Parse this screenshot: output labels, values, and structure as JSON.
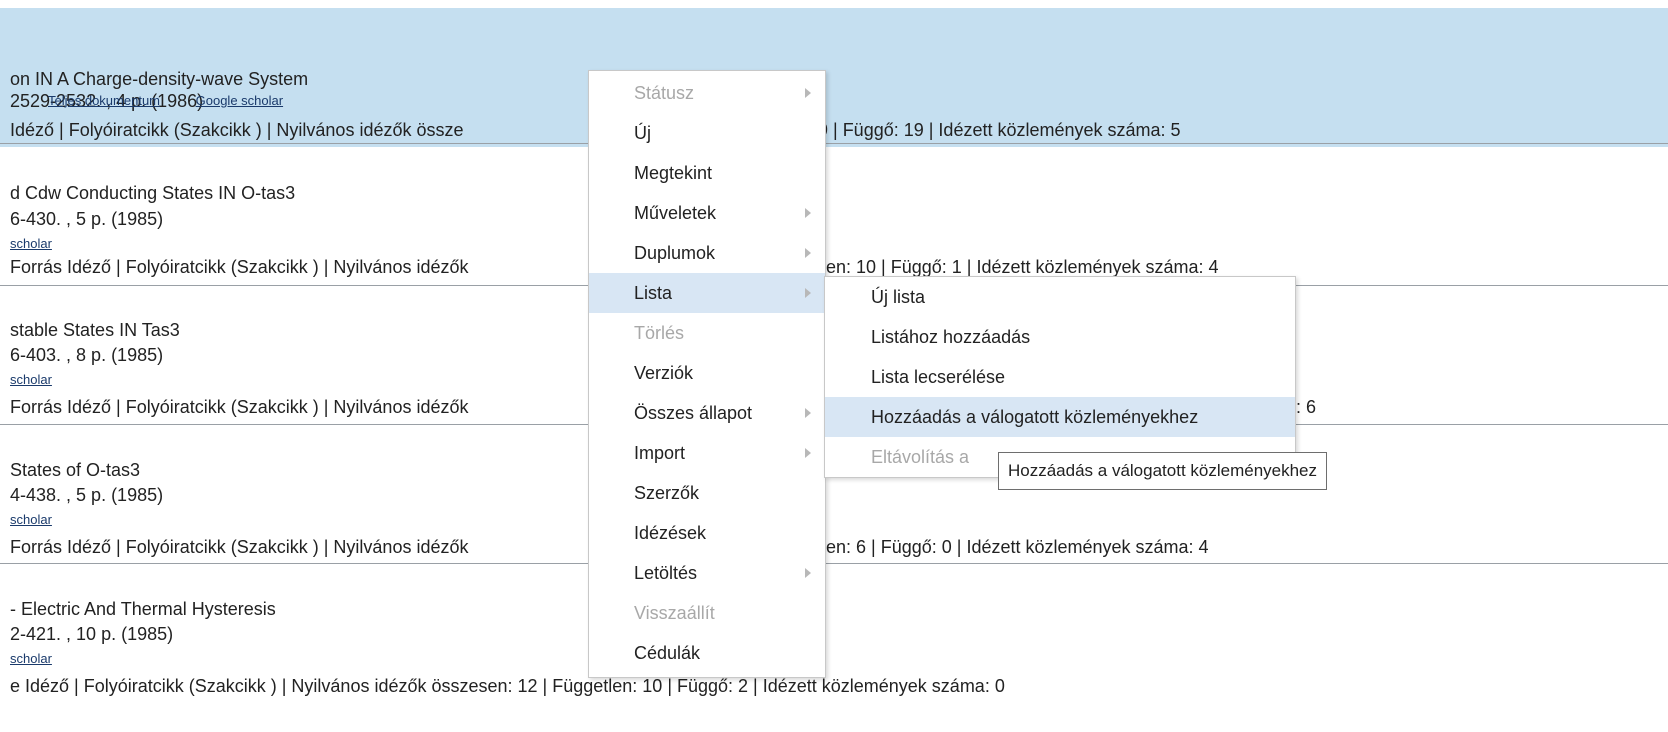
{
  "records": [
    {
      "title": "on IN A Charge-density-wave System",
      "pages": "2529-2532. , 4 p. (1986)",
      "links": [
        "Teljes dokumentum",
        "Google scholar"
      ],
      "meta": "Idéző | Folyóiratcikk (Szakcikk ) | Nyilvános idézők össze",
      "meta_right": "9 | Függő: 19 | Idézett közlemények száma: 5"
    },
    {
      "title": "d Cdw Conducting States IN O-tas3",
      "pages": "6-430. , 5 p. (1985)",
      "links": [
        "scholar"
      ],
      "meta": "Forrás Idéző | Folyóiratcikk (Szakcikk ) | Nyilvános idézők",
      "meta_right": "en: 10 | Függő: 1 | Idézett közlemények száma: 4"
    },
    {
      "title": "stable States IN Tas3",
      "pages": "6-403. , 8 p. (1985)",
      "links": [
        "scholar"
      ],
      "meta": "Forrás Idéző | Folyóiratcikk (Szakcikk ) | Nyilvános idézők",
      "meta_right": ": 6"
    },
    {
      "title": "States of O-tas3",
      "pages": "4-438. , 5 p. (1985)",
      "links": [
        "scholar"
      ],
      "meta": "Forrás Idéző | Folyóiratcikk (Szakcikk ) | Nyilvános idézők",
      "meta_right": "en: 6 | Függő: 0 | Idézett közlemények száma: 4"
    },
    {
      "title": "- Electric And Thermal Hysteresis",
      "pages": "2-421. , 10 p. (1985)",
      "links": [
        "scholar"
      ],
      "meta": "e Idéző | Folyóiratcikk (Szakcikk ) | Nyilvános idézők összesen: 12 | Független: 10 | Függő: 2 | Idézett közlemények száma: 0"
    }
  ],
  "context_menu": {
    "items": [
      {
        "label": "Státusz",
        "disabled": true,
        "submenu": true
      },
      {
        "label": "Új"
      },
      {
        "label": "Megtekint"
      },
      {
        "label": "Műveletek",
        "submenu": true
      },
      {
        "label": "Duplumok",
        "submenu": true
      },
      {
        "label": "Lista",
        "submenu": true,
        "active": true
      },
      {
        "label": "Törlés",
        "disabled": true
      },
      {
        "label": "Verziók"
      },
      {
        "label": "Összes állapot",
        "submenu": true
      },
      {
        "label": "Import",
        "submenu": true
      },
      {
        "label": "Szerzők"
      },
      {
        "label": "Idézések"
      },
      {
        "label": "Letöltés",
        "submenu": true
      },
      {
        "label": "Visszaállít",
        "disabled": true
      },
      {
        "label": "Cédulák"
      }
    ]
  },
  "lista_submenu": {
    "items": [
      {
        "label": "Új lista"
      },
      {
        "label": "Listához hozzáadás"
      },
      {
        "label": "Lista lecserélése"
      },
      {
        "label": "Hozzáadás a válogatott közleményekhez",
        "active": true
      },
      {
        "label": "Eltávolítás a",
        "disabled": true
      }
    ]
  },
  "tooltip": {
    "text": "Hozzáadás a válogatott közleményekhez"
  },
  "colors": {
    "selected_row": "#c5dff0",
    "menu_highlight": "#d8e6f4",
    "disabled_text": "#a8a8a8",
    "link": "#1a3a6b"
  }
}
